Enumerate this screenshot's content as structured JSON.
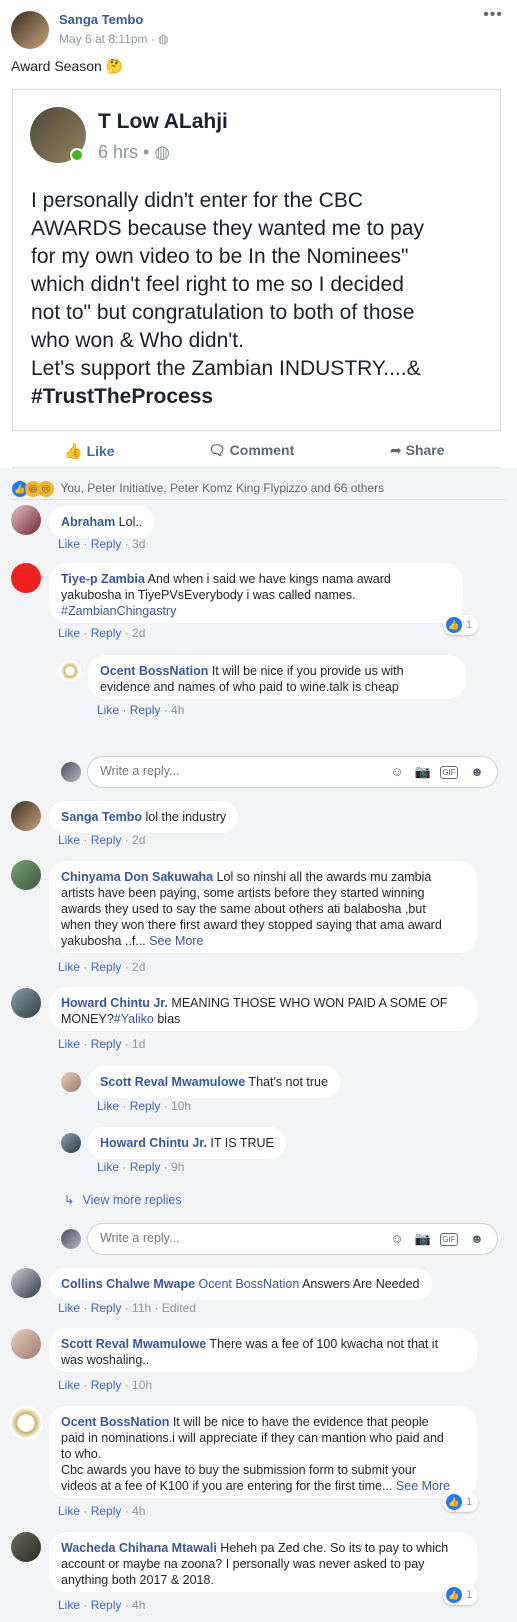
{
  "post": {
    "author": "Sanga Tembo",
    "time": "May 6 at 8:11pm",
    "text": "Award Season 🤔",
    "more_label": "•••"
  },
  "shared": {
    "author": "T Low ALahji",
    "meta": "6 hrs",
    "line1": "I personally didn't enter for the CBC",
    "line2": "AWARDS because they wanted me to pay",
    "line3": "for my own video to be In the Nominees\"",
    "line4": "which didn't feel right to me so I decided",
    "line5": "not to\" but congratulation  to both of  those",
    "line6": "who won & Who didn't.",
    "line7": "Let's support the Zambian INDUSTRY....&",
    "hashtag": "#TrustTheProcess"
  },
  "actions": {
    "like": "Like",
    "comment": "Comment",
    "share": "Share"
  },
  "reactions_summary": "You, Peter Initiative, Peter Komz King Flypizzo and 66 others",
  "reply_placeholder": "Write a reply...",
  "comments": {
    "c1": {
      "author": "Abraham",
      "text": " Lol..",
      "like": "Like",
      "reply": "Reply",
      "time": "3d"
    },
    "c2": {
      "author": "Tiye-p Zambia",
      "text1": " And when i said we have kings nama award",
      "text2": "yakubosha in TiyePVsEverybody i was called names.",
      "tag": "#ZambianChingastry",
      "like": "Like",
      "reply": "Reply",
      "time": "2d",
      "reactions": "1"
    },
    "c2r1": {
      "author": "Ocent BossNation",
      "text1": " It will be nice if you provide us with",
      "text2": "evidence and names of who paid to wine.talk is cheap",
      "like": "Like",
      "reply": "Reply",
      "time": "4h"
    },
    "c3": {
      "author": "Sanga Tembo",
      "text": " lol the industry",
      "like": "Like",
      "reply": "Reply",
      "time": "2d"
    },
    "c4": {
      "author": "Chinyama Don Sakuwaha",
      "text1": " Lol so ninshi all the awards mu zambia",
      "text2": "artists have been paying, some artists before they started winning",
      "text3": "awards they used to say the same about others ati balabosha ,but",
      "text4": "when they won there first award they stopped saying that ama award",
      "text5": "yakubosha ..f...",
      "see_more": "See More",
      "like": "Like",
      "reply": "Reply",
      "time": "2d"
    },
    "c5": {
      "author": "Howard Chintu Jr.",
      "text1": " MEANING THOSE WHO WON PAID A SOME OF",
      "text2": "MONEY?",
      "tag": "#Yaliko",
      "text3": " bias",
      "like": "Like",
      "reply": "Reply",
      "time": "1d"
    },
    "c5r1": {
      "author": "Scott Reval Mwamulowe",
      "text": " That's not true",
      "like": "Like",
      "reply": "Reply",
      "time": "10h"
    },
    "c5r2": {
      "author": "Howard Chintu Jr.",
      "text": " IT IS TRUE",
      "like": "Like",
      "reply": "Reply",
      "time": "9h"
    },
    "view_more": "View more replies",
    "c6": {
      "author": "Collins Chalwe Mwape",
      "tag": " Ocent BossNation",
      "text": " Answers Are Needed",
      "like": "Like",
      "reply": "Reply",
      "time": "11h",
      "edited": "Edited"
    },
    "c7": {
      "author": "Scott Reval Mwamulowe",
      "text1": " There was a fee of 100 kwacha not that it",
      "text2": "was woshaling..",
      "like": "Like",
      "reply": "Reply",
      "time": "10h"
    },
    "c8": {
      "author": "Ocent BossNation",
      "text1": " It will be nice to have the evidence that people",
      "text2": "paid in nominations.i will appreciate if they can mantion who paid and",
      "text3": "to who.",
      "text4": "Cbc awards you have to buy the submission form to submit your",
      "text5": "videos at a fee of K100 if you are entering for the first time...",
      "see_more": "See More",
      "like": "Like",
      "reply": "Reply",
      "time": "4h",
      "reactions": "1"
    },
    "c9": {
      "author": "Wacheda Chihana Mtawali",
      "text1": " Heheh pa Zed che. So its to pay to which",
      "text2": "account or maybe na zoona? I personally was never asked to pay",
      "text3": "anything both 2017 & 2018.",
      "like": "Like",
      "reply": "Reply",
      "time": "4h",
      "reactions": "1"
    }
  },
  "colors": {
    "link": "#365899",
    "like_blue": "#4267b2",
    "bg": "#f2f3f5",
    "meta": "#90949c"
  }
}
